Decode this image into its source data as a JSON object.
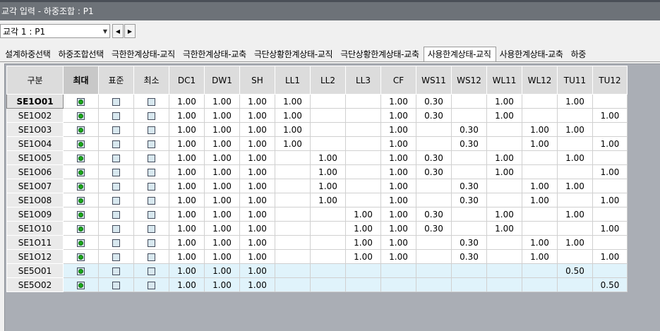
{
  "window": {
    "title": "교각 입력 - 하중조합 : P1"
  },
  "selector": {
    "value": "교각 1 : P1"
  },
  "tabs": [
    {
      "label": "설계하중선택"
    },
    {
      "label": "하중조합선택"
    },
    {
      "label": "극한한계상태-교직"
    },
    {
      "label": "극한한계상태-교축"
    },
    {
      "label": "극단상황한계상태-교직"
    },
    {
      "label": "극단상황한계상태-교축"
    },
    {
      "label": "사용한계상태-교직",
      "active": true
    },
    {
      "label": "사용한계상태-교축"
    },
    {
      "label": "하중"
    }
  ],
  "table": {
    "columns": [
      "구분",
      "최대",
      "표준",
      "최소",
      "DC1",
      "DW1",
      "SH",
      "LL1",
      "LL2",
      "LL3",
      "CF",
      "WS11",
      "WS12",
      "WL11",
      "WL12",
      "TU11",
      "TU12"
    ],
    "rows": [
      {
        "name": "SE1O01",
        "radio": 0,
        "values": [
          "1.00",
          "1.00",
          "1.00",
          "1.00",
          "",
          "",
          "1.00",
          "0.30",
          "",
          "1.00",
          "",
          "1.00",
          ""
        ]
      },
      {
        "name": "SE1O02",
        "radio": 0,
        "values": [
          "1.00",
          "1.00",
          "1.00",
          "1.00",
          "",
          "",
          "1.00",
          "0.30",
          "",
          "1.00",
          "",
          "",
          "1.00"
        ]
      },
      {
        "name": "SE1O03",
        "radio": 0,
        "values": [
          "1.00",
          "1.00",
          "1.00",
          "1.00",
          "",
          "",
          "1.00",
          "",
          "0.30",
          "",
          "1.00",
          "1.00",
          ""
        ]
      },
      {
        "name": "SE1O04",
        "radio": 0,
        "values": [
          "1.00",
          "1.00",
          "1.00",
          "1.00",
          "",
          "",
          "1.00",
          "",
          "0.30",
          "",
          "1.00",
          "",
          "1.00"
        ]
      },
      {
        "name": "SE1O05",
        "radio": 0,
        "values": [
          "1.00",
          "1.00",
          "1.00",
          "",
          "1.00",
          "",
          "1.00",
          "0.30",
          "",
          "1.00",
          "",
          "1.00",
          ""
        ]
      },
      {
        "name": "SE1O06",
        "radio": 0,
        "values": [
          "1.00",
          "1.00",
          "1.00",
          "",
          "1.00",
          "",
          "1.00",
          "0.30",
          "",
          "1.00",
          "",
          "",
          "1.00"
        ]
      },
      {
        "name": "SE1O07",
        "radio": 0,
        "values": [
          "1.00",
          "1.00",
          "1.00",
          "",
          "1.00",
          "",
          "1.00",
          "",
          "0.30",
          "",
          "1.00",
          "1.00",
          ""
        ]
      },
      {
        "name": "SE1O08",
        "radio": 0,
        "values": [
          "1.00",
          "1.00",
          "1.00",
          "",
          "1.00",
          "",
          "1.00",
          "",
          "0.30",
          "",
          "1.00",
          "",
          "1.00"
        ]
      },
      {
        "name": "SE1O09",
        "radio": 0,
        "values": [
          "1.00",
          "1.00",
          "1.00",
          "",
          "",
          "1.00",
          "1.00",
          "0.30",
          "",
          "1.00",
          "",
          "1.00",
          ""
        ]
      },
      {
        "name": "SE1O10",
        "radio": 0,
        "values": [
          "1.00",
          "1.00",
          "1.00",
          "",
          "",
          "1.00",
          "1.00",
          "0.30",
          "",
          "1.00",
          "",
          "",
          "1.00"
        ]
      },
      {
        "name": "SE1O11",
        "radio": 0,
        "values": [
          "1.00",
          "1.00",
          "1.00",
          "",
          "",
          "1.00",
          "1.00",
          "",
          "0.30",
          "",
          "1.00",
          "1.00",
          ""
        ]
      },
      {
        "name": "SE1O12",
        "radio": 0,
        "values": [
          "1.00",
          "1.00",
          "1.00",
          "",
          "",
          "1.00",
          "1.00",
          "",
          "0.30",
          "",
          "1.00",
          "",
          "1.00"
        ]
      },
      {
        "name": "SE5O01",
        "radio": 0,
        "highlight": true,
        "values": [
          "1.00",
          "1.00",
          "1.00",
          "",
          "",
          "",
          "",
          "",
          "",
          "",
          "",
          "0.50",
          ""
        ]
      },
      {
        "name": "SE5O02",
        "radio": 0,
        "highlight": true,
        "values": [
          "1.00",
          "1.00",
          "1.00",
          "",
          "",
          "",
          "",
          "",
          "",
          "",
          "",
          "",
          "0.50"
        ]
      }
    ]
  }
}
